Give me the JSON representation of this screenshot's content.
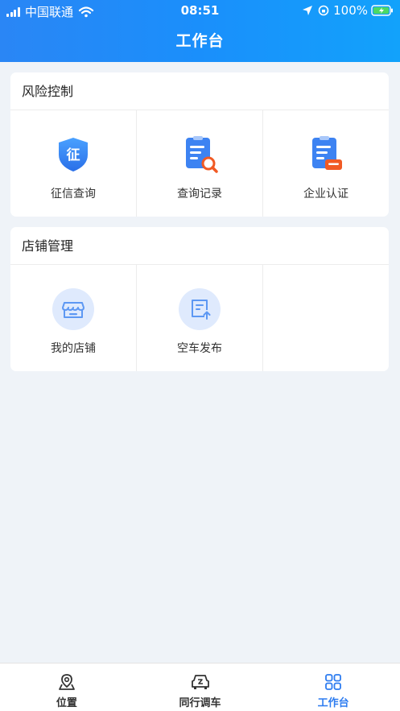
{
  "status_bar": {
    "carrier": "中国联通",
    "time": "08:51",
    "battery": "100%"
  },
  "header": {
    "title": "工作台"
  },
  "sections": [
    {
      "title": "风险控制",
      "items": [
        {
          "label": "征信查询",
          "icon": "credit-shield-icon",
          "glyph": "征"
        },
        {
          "label": "查询记录",
          "icon": "query-record-icon"
        },
        {
          "label": "企业认证",
          "icon": "enterprise-cert-icon"
        }
      ]
    },
    {
      "title": "店铺管理",
      "items": [
        {
          "label": "我的店铺",
          "icon": "store-icon"
        },
        {
          "label": "空车发布",
          "icon": "publish-icon"
        }
      ]
    }
  ],
  "tabbar": [
    {
      "label": "位置",
      "icon": "location-icon",
      "active": false
    },
    {
      "label": "同行调车",
      "icon": "car-icon",
      "active": false
    },
    {
      "label": "工作台",
      "icon": "grid-icon",
      "active": true
    }
  ],
  "colors": {
    "accent": "#2d7cf0",
    "header": "#1a8ffb",
    "warn": "#f15a24"
  }
}
